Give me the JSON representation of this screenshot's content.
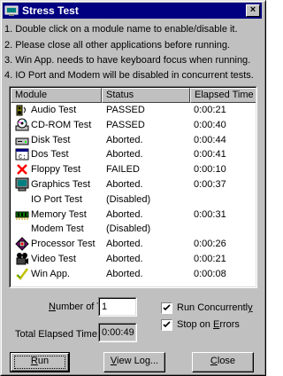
{
  "window": {
    "title": "Stress Test",
    "close_label": "×"
  },
  "instructions": [
    "1.  Double click on a module name to enable/disable it.",
    "2.  Please close all other applications before running.",
    "3.  Win App. needs to have keyboard focus when running.",
    "4.  IO Port and Modem will be disabled in concurrent tests."
  ],
  "table": {
    "columns": [
      "Module",
      "Status",
      "Elapsed Time"
    ],
    "rows": [
      {
        "module": "Audio Test",
        "status": "PASSED",
        "time": "0:00:21",
        "icon": "speaker-icon"
      },
      {
        "module": "CD-ROM Test",
        "status": "PASSED",
        "time": "0:00:40",
        "icon": "cdrom-icon"
      },
      {
        "module": "Disk Test",
        "status": "Aborted.",
        "time": "0:00:44",
        "icon": "hard-disk-icon"
      },
      {
        "module": "Dos Test",
        "status": "Aborted.",
        "time": "0:00:41",
        "icon": "dos-window-icon"
      },
      {
        "module": "Floppy Test",
        "status": "FAILED",
        "time": "0:00:10",
        "icon": "failed-x-icon"
      },
      {
        "module": "Graphics Test",
        "status": "Aborted.",
        "time": "0:00:37",
        "icon": "monitor-icon"
      },
      {
        "module": "IO Port Test",
        "status": "(Disabled)",
        "time": "",
        "icon": ""
      },
      {
        "module": "Memory Test",
        "status": "Aborted.",
        "time": "0:00:31",
        "icon": "memory-chip-icon"
      },
      {
        "module": "Modem Test",
        "status": "(Disabled)",
        "time": "",
        "icon": ""
      },
      {
        "module": "Processor Test",
        "status": "Aborted.",
        "time": "0:00:26",
        "icon": "processor-icon"
      },
      {
        "module": "Video Test",
        "status": "Aborted.",
        "time": "0:00:21",
        "icon": "video-camera-icon"
      },
      {
        "module": "Win App.",
        "status": "Aborted.",
        "time": "0:00:08",
        "icon": "checkmark-icon"
      }
    ]
  },
  "controls": {
    "num_tests_label": "Number of Tests:",
    "num_tests_value": "1",
    "total_elapsed_label": "Total Elapsed Time:",
    "total_elapsed_value": "0:00:49",
    "run_concurrently_label": "Run Concurrently",
    "run_concurrently_checked": true,
    "stop_on_errors_label": "Stop on Errors",
    "stop_on_errors_checked": true
  },
  "buttons": {
    "run": "Run",
    "view_log": "View Log...",
    "close": "Close"
  }
}
